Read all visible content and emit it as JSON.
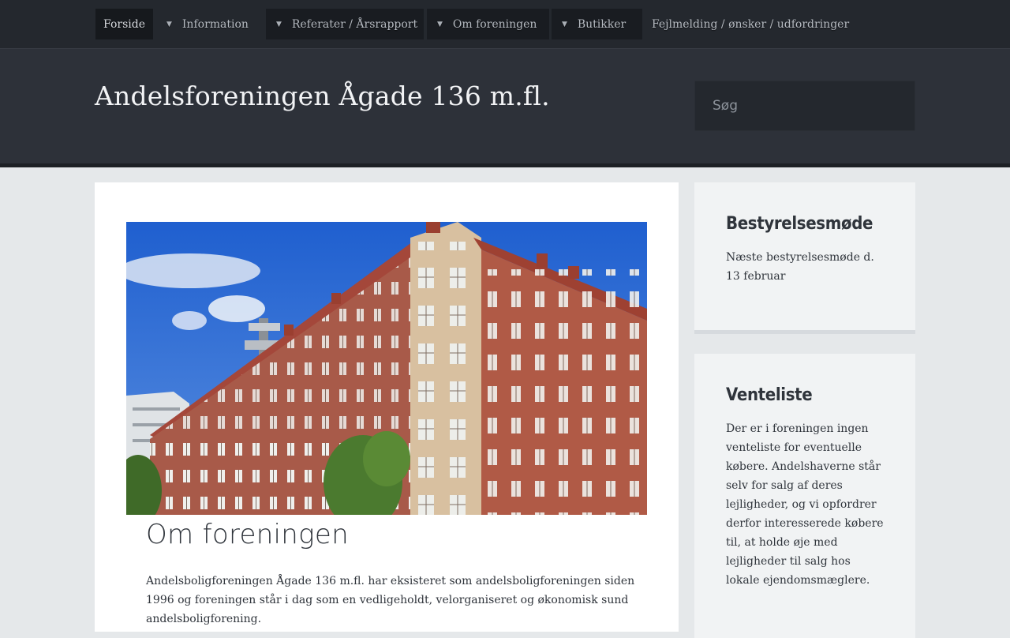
{
  "nav": {
    "items": [
      {
        "label": "Forside",
        "has_dropdown": false
      },
      {
        "label": "Information",
        "has_dropdown": true
      },
      {
        "label": "Referater / Årsrapport",
        "has_dropdown": true
      },
      {
        "label": "Om foreningen",
        "has_dropdown": true
      },
      {
        "label": "Butikker",
        "has_dropdown": true
      },
      {
        "label": "Fejlmelding / ønsker / udfordringer",
        "has_dropdown": false
      }
    ],
    "arrow": "▼"
  },
  "header": {
    "site_title": "Andelsforeningen Ågade 136 m.fl.",
    "search_placeholder": "Søg"
  },
  "main": {
    "title": "Om foreningen",
    "body": "Andelsboligforeningen Ågade 136 m.fl. har eksisteret som andelsboligforeningen siden 1996 og foreningen står i dag som en vedligeholdt, velorganiseret og økonomisk sund andelsboligforening."
  },
  "sidebar": {
    "widgets": [
      {
        "title": "Bestyrelsesmøde",
        "text": "Næste bestyrelsesmøde d. 13 februar"
      },
      {
        "title": "Venteliste",
        "text": "Der er i foreningen ingen venteliste for eventuelle købere. Andelshaverne står selv for salg af deres lejligheder, og vi opfordrer derfor interesserede købere til, at holde øje med lejligheder til salg hos lokale ejendomsmæglere."
      }
    ]
  },
  "colors": {
    "nav_bg": "#24282e",
    "header_bg": "#2d3139",
    "page_bg": "#e5e8ea",
    "widget_bg": "#f1f3f4"
  }
}
